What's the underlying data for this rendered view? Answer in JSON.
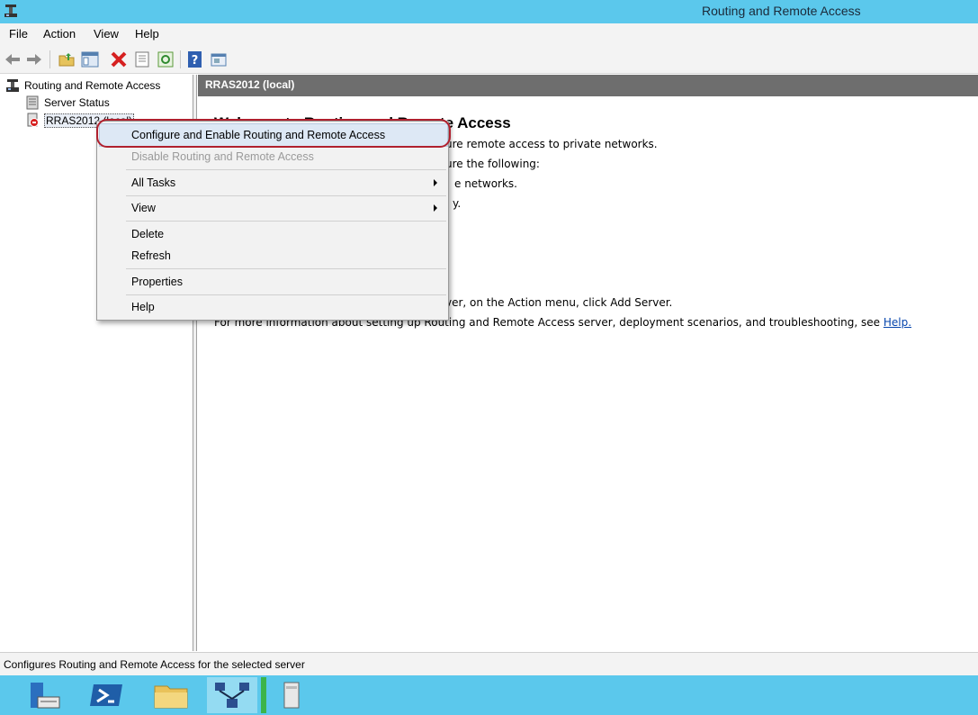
{
  "window": {
    "title": "Routing and Remote Access",
    "app_icon": "rras-icon"
  },
  "menubar": {
    "items": [
      "File",
      "Action",
      "View",
      "Help"
    ]
  },
  "toolbar": {
    "buttons": [
      "back-icon",
      "forward-icon",
      "up-folder-icon",
      "show-hide-tree-icon",
      "delete-icon",
      "properties-icon",
      "refresh-icon",
      "help-icon",
      "console-icon"
    ]
  },
  "tree": {
    "root": "Routing and Remote Access",
    "items": [
      {
        "label": "Server Status",
        "icon": "server-status-icon"
      },
      {
        "label": "RRAS2012 (local)",
        "icon": "server-stopped-icon"
      }
    ]
  },
  "content": {
    "header": "RRAS2012 (local)",
    "welcome_title": "Welcome to Routing and Remote Access",
    "lines": [
      "ure remote access to private networks.",
      "ure the following:",
      "e networks.",
      "y.",
      "ver, on the Action menu, click Add Server."
    ],
    "more_info": "For more information about setting up Routing and Remote Access server, deployment scenarios, and troubleshooting, see ",
    "help_link": "Help."
  },
  "context_menu": {
    "items": [
      {
        "label": "Configure and Enable Routing and Remote Access",
        "enabled": true,
        "highlighted": true
      },
      {
        "label": "Disable Routing and Remote Access",
        "enabled": false
      },
      {
        "label": "All Tasks",
        "enabled": true,
        "submenu": true
      },
      {
        "label": "View",
        "enabled": true,
        "submenu": true
      },
      {
        "label": "Delete",
        "enabled": true
      },
      {
        "label": "Refresh",
        "enabled": true
      },
      {
        "label": "Properties",
        "enabled": true
      },
      {
        "label": "Help",
        "enabled": true
      }
    ],
    "highlight_color": "#b0202e"
  },
  "statusbar": {
    "text": "Configures Routing and Remote Access for the selected server"
  },
  "taskbar": {
    "items": [
      "server-manager-icon",
      "powershell-icon",
      "file-explorer-icon",
      "rras-network-icon",
      "server-storage-icon"
    ]
  }
}
